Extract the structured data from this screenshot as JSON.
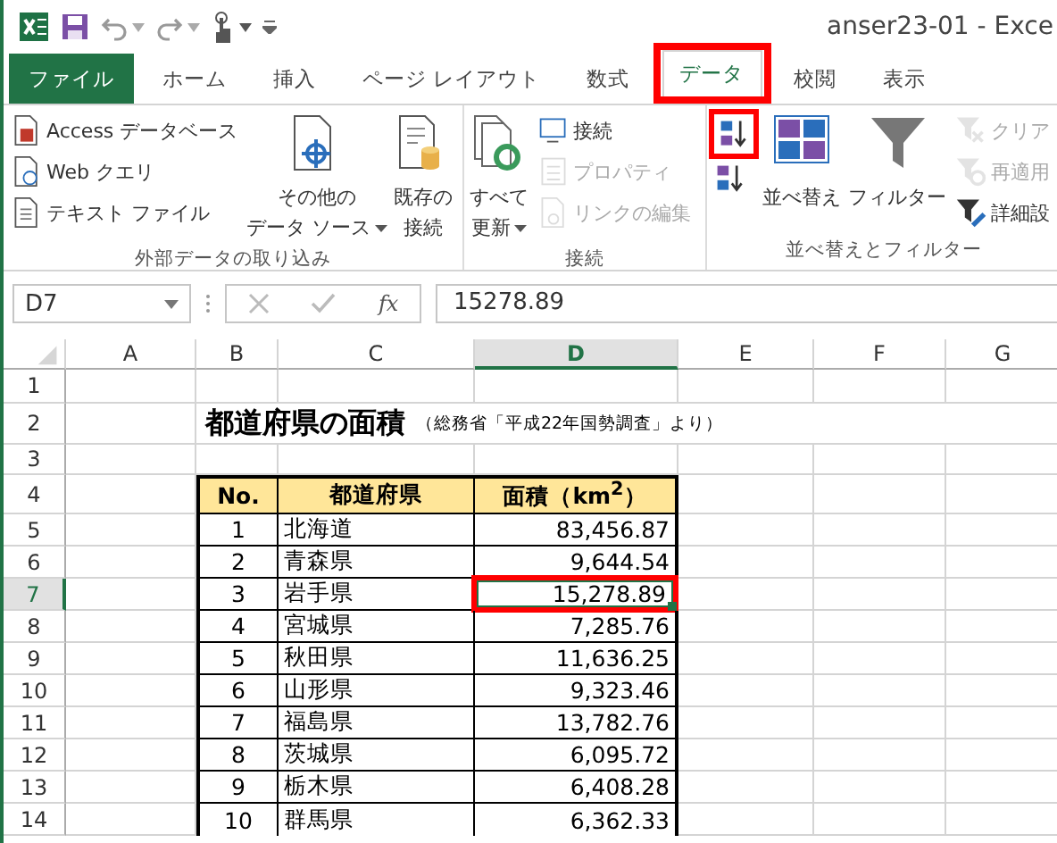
{
  "title_bar": {
    "title": "anser23-01 - Exce"
  },
  "tabs": [
    {
      "label": "ファイル",
      "kind": "file",
      "selected": false,
      "highlighted": false
    },
    {
      "label": "ホーム",
      "kind": "tab",
      "selected": false,
      "highlighted": false
    },
    {
      "label": "挿入",
      "kind": "tab",
      "selected": false,
      "highlighted": false
    },
    {
      "label": "ページ レイアウト",
      "kind": "tab",
      "selected": false,
      "highlighted": false
    },
    {
      "label": "数式",
      "kind": "tab",
      "selected": false,
      "highlighted": false
    },
    {
      "label": "データ",
      "kind": "tab",
      "selected": true,
      "highlighted": true
    },
    {
      "label": "校閲",
      "kind": "tab",
      "selected": false,
      "highlighted": false
    },
    {
      "label": "表示",
      "kind": "tab",
      "selected": false,
      "highlighted": false
    }
  ],
  "ribbon": {
    "groups": [
      {
        "label": "外部データの取り込み",
        "items": [
          {
            "kind": "stack",
            "items": [
              {
                "label": "Access データベース",
                "disabled": false,
                "highlighted": false
              },
              {
                "label": "Web クエリ",
                "disabled": false,
                "highlighted": false
              },
              {
                "label": "テキスト ファイル",
                "disabled": false,
                "highlighted": false
              }
            ]
          },
          {
            "kind": "large",
            "lines": [
              "その他の",
              "データ ソース"
            ],
            "dropdown": true
          },
          {
            "kind": "large",
            "lines": [
              "既存の",
              "接続"
            ],
            "dropdown": false
          }
        ]
      },
      {
        "label": "接続",
        "items": [
          {
            "kind": "large",
            "lines": [
              "すべて",
              "更新"
            ],
            "dropdown": true
          },
          {
            "kind": "stack",
            "items": [
              {
                "label": "接続",
                "disabled": false,
                "highlighted": false
              },
              {
                "label": "プロパティ",
                "disabled": true,
                "highlighted": false
              },
              {
                "label": "リンクの編集",
                "disabled": true,
                "highlighted": false
              }
            ]
          }
        ]
      },
      {
        "label": "並べ替えとフィルター",
        "items": [
          {
            "kind": "stack",
            "items": [
              {
                "disabled": false,
                "highlighted": true
              },
              {
                "disabled": false,
                "highlighted": false
              }
            ]
          },
          {
            "kind": "large",
            "lines": [
              "並べ替え"
            ],
            "dropdown": false
          },
          {
            "kind": "large",
            "lines": [
              "フィルター"
            ],
            "dropdown": false
          },
          {
            "kind": "stack",
            "items": [
              {
                "label": "クリア",
                "disabled": true,
                "highlighted": false
              },
              {
                "label": "再適用",
                "disabled": true,
                "highlighted": false
              },
              {
                "label": "詳細設",
                "disabled": false,
                "highlighted": false
              }
            ]
          }
        ]
      }
    ]
  },
  "formula_bar": {
    "name_box": "D7",
    "function_label": "fx",
    "formula": "15278.89"
  },
  "sheet": {
    "columns": [
      {
        "label": "A",
        "selected": false
      },
      {
        "label": "B",
        "selected": false
      },
      {
        "label": "C",
        "selected": false
      },
      {
        "label": "D",
        "selected": true
      },
      {
        "label": "E",
        "selected": false
      },
      {
        "label": "F",
        "selected": false
      },
      {
        "label": "G",
        "selected": false
      }
    ],
    "rows": [
      {
        "label": "1",
        "selected": false
      },
      {
        "label": "2",
        "selected": false
      },
      {
        "label": "3",
        "selected": false
      },
      {
        "label": "4",
        "selected": false
      },
      {
        "label": "5",
        "selected": false
      },
      {
        "label": "6",
        "selected": false
      },
      {
        "label": "7",
        "selected": true
      },
      {
        "label": "8",
        "selected": false
      },
      {
        "label": "9",
        "selected": false
      },
      {
        "label": "10",
        "selected": false
      },
      {
        "label": "11",
        "selected": false
      },
      {
        "label": "12",
        "selected": false
      },
      {
        "label": "13",
        "selected": false
      },
      {
        "label": "14",
        "selected": false
      }
    ],
    "title": "都道府県の面積",
    "subtitle": "（総務省「平成22年国勢調査」より）",
    "table": {
      "columns": [
        "No.",
        "都道府県",
        "面積（km$^{2}$）"
      ],
      "rows": [
        {
          "no": "1",
          "prefecture": "北海道",
          "area": "83,456.87",
          "selected": false,
          "highlighted": false
        },
        {
          "no": "2",
          "prefecture": "青森県",
          "area": "9,644.54",
          "selected": false,
          "highlighted": false
        },
        {
          "no": "3",
          "prefecture": "岩手県",
          "area": "15,278.89",
          "selected": true,
          "highlighted": true
        },
        {
          "no": "4",
          "prefecture": "宮城県",
          "area": "7,285.76",
          "selected": false,
          "highlighted": false
        },
        {
          "no": "5",
          "prefecture": "秋田県",
          "area": "11,636.25",
          "selected": false,
          "highlighted": false
        },
        {
          "no": "6",
          "prefecture": "山形県",
          "area": "9,323.46",
          "selected": false,
          "highlighted": false
        },
        {
          "no": "7",
          "prefecture": "福島県",
          "area": "13,782.76",
          "selected": false,
          "highlighted": false
        },
        {
          "no": "8",
          "prefecture": "茨城県",
          "area": "6,095.72",
          "selected": false,
          "highlighted": false
        },
        {
          "no": "9",
          "prefecture": "栃木県",
          "area": "6,408.28",
          "selected": false,
          "highlighted": false
        },
        {
          "no": "10",
          "prefecture": "群馬県",
          "area": "6,362.33",
          "selected": false,
          "highlighted": false
        }
      ]
    }
  }
}
